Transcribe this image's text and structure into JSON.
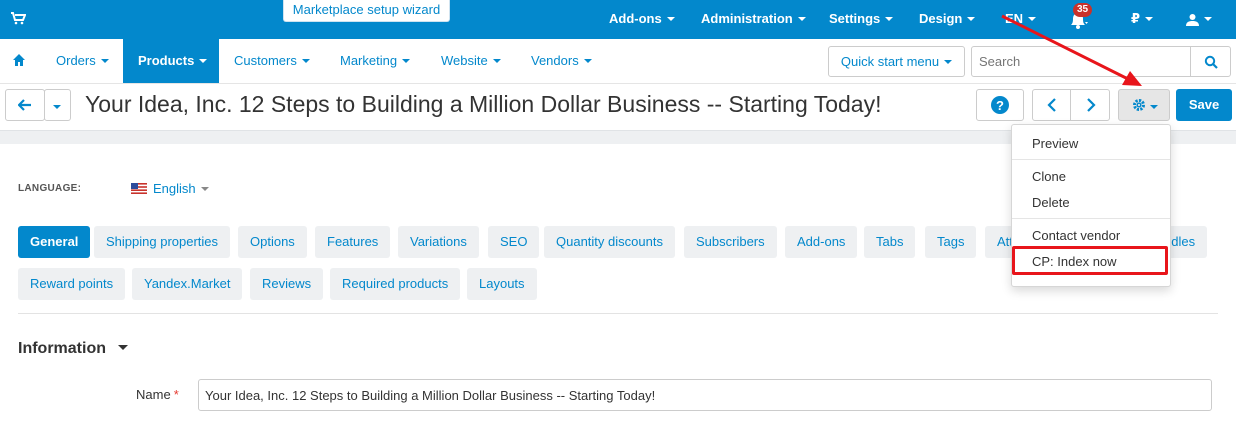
{
  "topbar": {
    "cart_icon": "cart-icon",
    "wizard_label": "Marketplace setup wizard",
    "menus": [
      "Add-ons",
      "Administration",
      "Settings",
      "Design"
    ],
    "language": "EN",
    "notifications_count": "35",
    "currency": "₽",
    "bell_icon": "bell-icon",
    "user_icon": "user-icon",
    "bg_color": "#0388cc"
  },
  "nav": {
    "home_icon": "home-icon",
    "items": [
      "Orders",
      "Products",
      "Customers",
      "Marketing",
      "Website",
      "Vendors"
    ],
    "active": "Products",
    "quick_start": "Quick start menu",
    "search_placeholder": "Search"
  },
  "titlebar": {
    "title": "Your Idea, Inc. 12 Steps to Building a Million Dollar Business -- Starting Today!",
    "save_label": "Save"
  },
  "language": {
    "label": "LANGUAGE:",
    "value": "English"
  },
  "tabs": {
    "row1": [
      "General",
      "Shipping properties",
      "Options",
      "Features",
      "Variations",
      "SEO",
      "Quantity discounts",
      "Subscribers",
      "Add-ons",
      "Tabs",
      "Tags",
      "Att",
      "ndles"
    ],
    "row2": [
      "Reward points",
      "Yandex.Market",
      "Reviews",
      "Required products",
      "Layouts"
    ],
    "active": "General"
  },
  "information": {
    "heading": "Information",
    "name_label": "Name",
    "name_value": "Your Idea, Inc. 12 Steps to Building a Million Dollar Business -- Starting Today!"
  },
  "dropdown": {
    "items": [
      "Preview",
      "Clone",
      "Delete",
      "Contact vendor",
      "CP: Index now"
    ],
    "highlighted": "CP: Index now"
  },
  "annotation_color": "#e8151b"
}
